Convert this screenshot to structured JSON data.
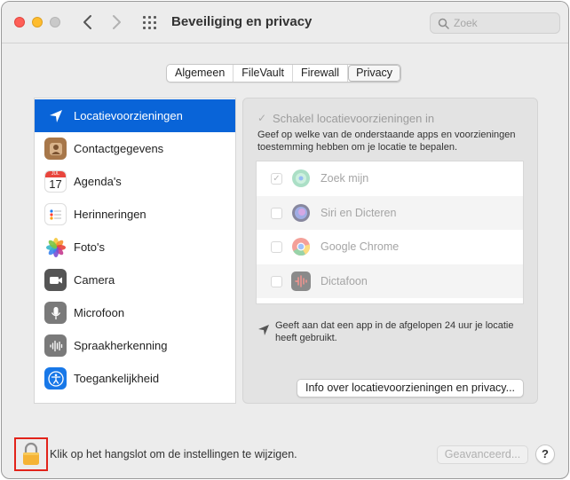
{
  "window": {
    "title": "Beveiliging en privacy"
  },
  "search": {
    "placeholder": "Zoek"
  },
  "tabs": [
    {
      "label": "Algemeen",
      "active": false
    },
    {
      "label": "FileVault",
      "active": false
    },
    {
      "label": "Firewall",
      "active": false
    },
    {
      "label": "Privacy",
      "active": true
    }
  ],
  "sidebar": {
    "items": [
      {
        "label": "Locatievoorzieningen",
        "icon": "location-arrow-icon",
        "selected": true
      },
      {
        "label": "Contactgegevens",
        "icon": "contacts-icon"
      },
      {
        "label": "Agenda's",
        "icon": "calendar-icon",
        "calendar_month": "JUL",
        "calendar_day": "17"
      },
      {
        "label": "Herinneringen",
        "icon": "reminders-icon"
      },
      {
        "label": "Foto's",
        "icon": "photos-icon"
      },
      {
        "label": "Camera",
        "icon": "camera-icon"
      },
      {
        "label": "Microfoon",
        "icon": "microphone-icon"
      },
      {
        "label": "Spraakherkenning",
        "icon": "speech-recognition-icon"
      },
      {
        "label": "Toegankelijkheid",
        "icon": "accessibility-icon"
      }
    ]
  },
  "panel": {
    "enable_label": "Schakel locatievoorzieningen in",
    "enable_checked": true,
    "description": "Geef op welke van de onderstaande apps en voorzieningen toestemming hebben om je locatie te bepalen.",
    "apps": [
      {
        "name": "Zoek mijn",
        "checked": true,
        "icon": "find-my-icon"
      },
      {
        "name": "Siri en Dicteren",
        "checked": false,
        "icon": "siri-icon"
      },
      {
        "name": "Google Chrome",
        "checked": false,
        "icon": "chrome-icon"
      },
      {
        "name": "Dictafoon",
        "checked": false,
        "icon": "voice-memos-icon"
      }
    ],
    "legend": "Geeft aan dat een app in de afgelopen 24 uur je locatie heeft gebruikt.",
    "info_button": "Info over locatievoorzieningen en privacy..."
  },
  "footer": {
    "lock_text": "Klik op het hangslot om de instellingen te wijzigen.",
    "advanced_button": "Geavanceerd...",
    "help_button": "?"
  },
  "colors": {
    "selection": "#0964d8",
    "lock_highlight": "#e2231a",
    "lock_body": "#f5b335"
  }
}
